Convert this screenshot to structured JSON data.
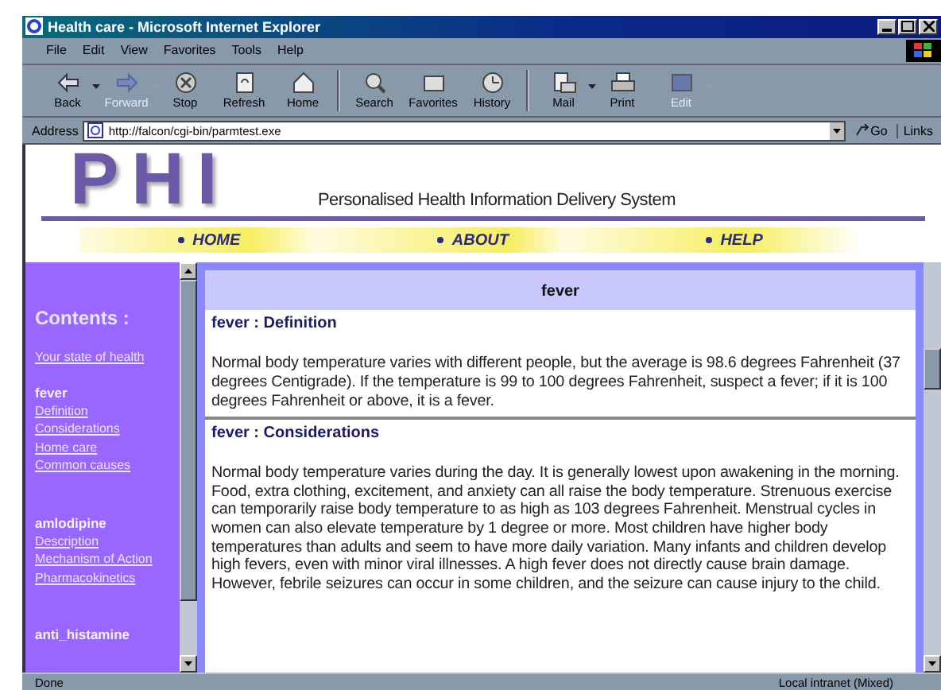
{
  "window": {
    "title": "Health care - Microsoft Internet Explorer"
  },
  "menu": [
    "File",
    "Edit",
    "View",
    "Favorites",
    "Tools",
    "Help"
  ],
  "toolbar": [
    {
      "label": "Back",
      "disabled": false,
      "has_menu": true
    },
    {
      "label": "Forward",
      "disabled": true,
      "has_menu": true
    },
    {
      "label": "Stop",
      "disabled": false,
      "has_menu": false
    },
    {
      "label": "Refresh",
      "disabled": false,
      "has_menu": false
    },
    {
      "label": "Home",
      "disabled": false,
      "has_menu": false
    },
    {
      "label": "Search",
      "disabled": false,
      "has_menu": false
    },
    {
      "label": "Favorites",
      "disabled": false,
      "has_menu": false
    },
    {
      "label": "History",
      "disabled": false,
      "has_menu": false
    },
    {
      "label": "Mail",
      "disabled": false,
      "has_menu": true
    },
    {
      "label": "Print",
      "disabled": false,
      "has_menu": false
    },
    {
      "label": "Edit",
      "disabled": true,
      "has_menu": true
    }
  ],
  "address": {
    "label": "Address",
    "value": "http://falcon/cgi-bin/parmtest.exe",
    "go": "Go",
    "links": "Links"
  },
  "header": {
    "logo": "PHI",
    "tagline": "Personalised Health Information Delivery System",
    "nav": [
      "HOME",
      "ABOUT",
      "HELP"
    ]
  },
  "sidebar": {
    "heading": "Contents :",
    "top_link": "Your state of health",
    "sections": [
      {
        "title": "fever",
        "links": [
          "Definition",
          "Considerations",
          "Home care",
          "Common causes"
        ]
      },
      {
        "title": "amlodipine",
        "links": [
          "Description",
          "Mechanism of Action",
          "Pharmacokinetics"
        ]
      },
      {
        "title": "anti_histamine"
      }
    ]
  },
  "main": {
    "title": "fever",
    "sections": [
      {
        "heading": "fever : Definition",
        "body": "Normal body temperature varies with different people, but the average is 98.6 degrees Fahrenheit (37 degrees Centigrade). If the temperature is 99 to 100 degrees Fahrenheit, suspect a fever; if it is 100 degrees Fahrenheit or above, it is a fever."
      },
      {
        "heading": "fever : Considerations",
        "body": "Normal body temperature varies during the day. It is generally lowest upon awakening in the morning. Food, extra clothing, excitement, and anxiety can all raise the body temperature. Strenuous exercise can temporarily raise body temperature to as high as 103 degrees Fahrenheit. Menstrual cycles in women can also elevate temperature by 1 degree or more. Most children have higher body temperatures than adults and seem to have more daily variation. Many infants and children develop high fevers, even with minor viral illnesses. A high fever does not directly cause brain damage. However, febrile seizures can occur in some children, and the seizure can cause injury to the child."
      }
    ]
  },
  "status": {
    "text": "Done",
    "zone": "Local intranet (Mixed)"
  }
}
